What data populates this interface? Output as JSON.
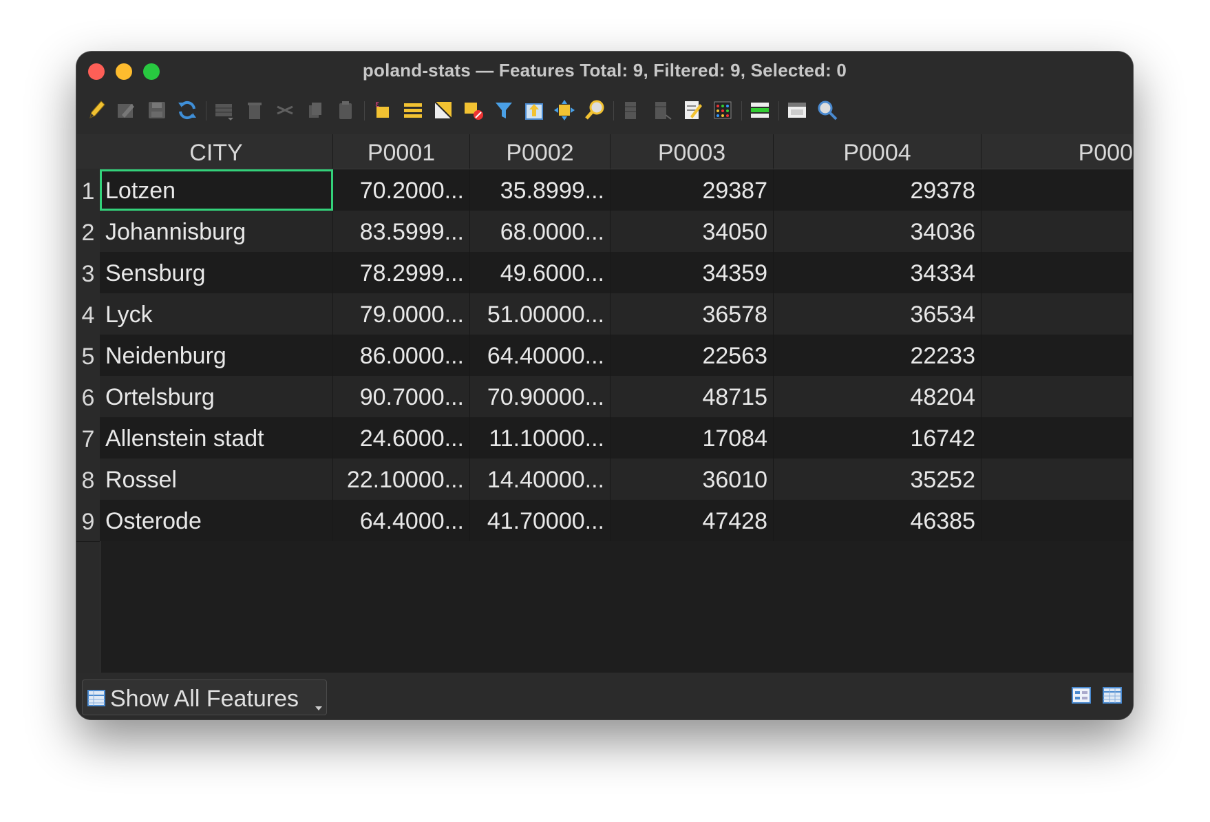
{
  "window": {
    "title": "poland-stats — Features Total: 9, Filtered: 9, Selected: 0"
  },
  "toolbar": {
    "icons": [
      "toggle-editing-icon",
      "multi-edit-icon",
      "save-edits-icon",
      "reload-icon",
      "add-feature-icon",
      "delete-feature-icon",
      "cut-icon",
      "copy-icon",
      "paste-icon",
      "select-by-expression-icon",
      "select-all-icon",
      "invert-selection-icon",
      "deselect-all-icon",
      "filter-select-icon",
      "move-selection-top-icon",
      "pan-to-selection-icon",
      "zoom-to-selection-icon",
      "new-field-icon",
      "delete-field-icon",
      "field-calculator-icon",
      "conditional-formatting-icon",
      "actions-icon",
      "dock-table-icon",
      "search-icon"
    ]
  },
  "table": {
    "columns": [
      "CITY",
      "P0001",
      "P0002",
      "P0003",
      "P0004",
      "P000"
    ],
    "rows": [
      {
        "num": "1",
        "city": "Lotzen",
        "p1": "70.2000...",
        "p2": "35.8999...",
        "p3": "29387",
        "p4": "29378"
      },
      {
        "num": "2",
        "city": "Johannisburg",
        "p1": "83.5999...",
        "p2": "68.0000...",
        "p3": "34050",
        "p4": "34036"
      },
      {
        "num": "3",
        "city": "Sensburg",
        "p1": "78.2999...",
        "p2": "49.6000...",
        "p3": "34359",
        "p4": "34334"
      },
      {
        "num": "4",
        "city": "Lyck",
        "p1": "79.0000...",
        "p2": "51.00000...",
        "p3": "36578",
        "p4": "36534"
      },
      {
        "num": "5",
        "city": "Neidenburg",
        "p1": "86.0000...",
        "p2": "64.40000...",
        "p3": "22563",
        "p4": "22233"
      },
      {
        "num": "6",
        "city": "Ortelsburg",
        "p1": "90.7000...",
        "p2": "70.90000...",
        "p3": "48715",
        "p4": "48204"
      },
      {
        "num": "7",
        "city": "Allenstein stadt",
        "p1": "24.6000...",
        "p2": "11.10000...",
        "p3": "17084",
        "p4": "16742"
      },
      {
        "num": "8",
        "city": "Rossel",
        "p1": "22.10000...",
        "p2": "14.40000...",
        "p3": "36010",
        "p4": "35252"
      },
      {
        "num": "9",
        "city": "Osterode",
        "p1": "64.4000...",
        "p2": "41.70000...",
        "p3": "47428",
        "p4": "46385"
      }
    ],
    "selected_cell": "Lotzen"
  },
  "scrollbar": {
    "thumb_fraction": 0.68
  },
  "footer": {
    "filter_label": "Show All Features",
    "view_icons": [
      "form-view-icon",
      "table-view-icon"
    ]
  },
  "colors": {
    "selection_border": "#33d17a",
    "close": "#fe5f57",
    "minimize": "#febc2e",
    "zoom": "#28c840"
  }
}
